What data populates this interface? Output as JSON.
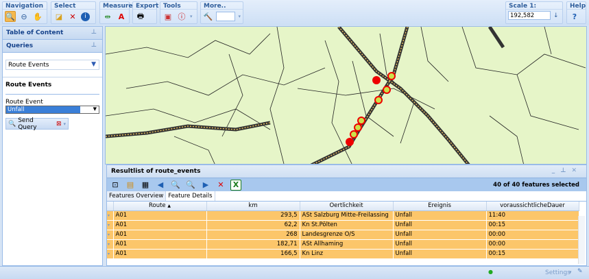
{
  "toolbar": {
    "groups": [
      {
        "title": "Navigation",
        "icons": [
          "zoom-in-icon",
          "zoom-out-icon",
          "pan-hand-icon"
        ]
      },
      {
        "title": "Select",
        "icons": [
          "select-icon",
          "clear-selection-icon",
          "info-icon"
        ]
      },
      {
        "title": "Measure",
        "icons": [
          "measure-distance-icon",
          "measure-area-icon"
        ]
      },
      {
        "title": "Export",
        "icons": [
          "print-icon"
        ]
      },
      {
        "title": "Tools",
        "icons": [
          "tool-icon",
          "tooltip-icon"
        ]
      },
      {
        "title": "More..",
        "icons": [
          "hammer-icon"
        ]
      }
    ],
    "scale_label": "Scale 1:",
    "scale_value": "192,582",
    "help_label": "Help"
  },
  "left": {
    "toc_title": "Table of Content",
    "queries_title": "Queries",
    "query_select": "Route Events",
    "section_title": "Route Events",
    "route_event_label": "Route Event",
    "route_event_value": "Unfall",
    "send_query": "Send Query"
  },
  "results": {
    "title": "Resultlist of route_events",
    "selected": "40 of 40 features selected",
    "tabs": [
      "Features Overview",
      "Feature Details"
    ],
    "columns": [
      "Route",
      "km",
      "Oertlichkeit",
      "Ereignis",
      "voraussichtlicheDauer"
    ],
    "rows": [
      [
        "A01",
        "293,5",
        "ASt Salzburg Mitte-Freilassing",
        "Unfall",
        "11:40"
      ],
      [
        "A01",
        "62,2",
        "Kn St.Pölten",
        "Unfall",
        "00:15"
      ],
      [
        "A01",
        "268",
        "Landesgrenze O/S",
        "Unfall",
        "00:00"
      ],
      [
        "A01",
        "182,71",
        "ASt Allhaming",
        "Unfall",
        "00:00"
      ],
      [
        "A01",
        "166,5",
        "Kn Linz",
        "Unfall",
        "00:15"
      ]
    ]
  },
  "status": {
    "settings": "Settings"
  }
}
